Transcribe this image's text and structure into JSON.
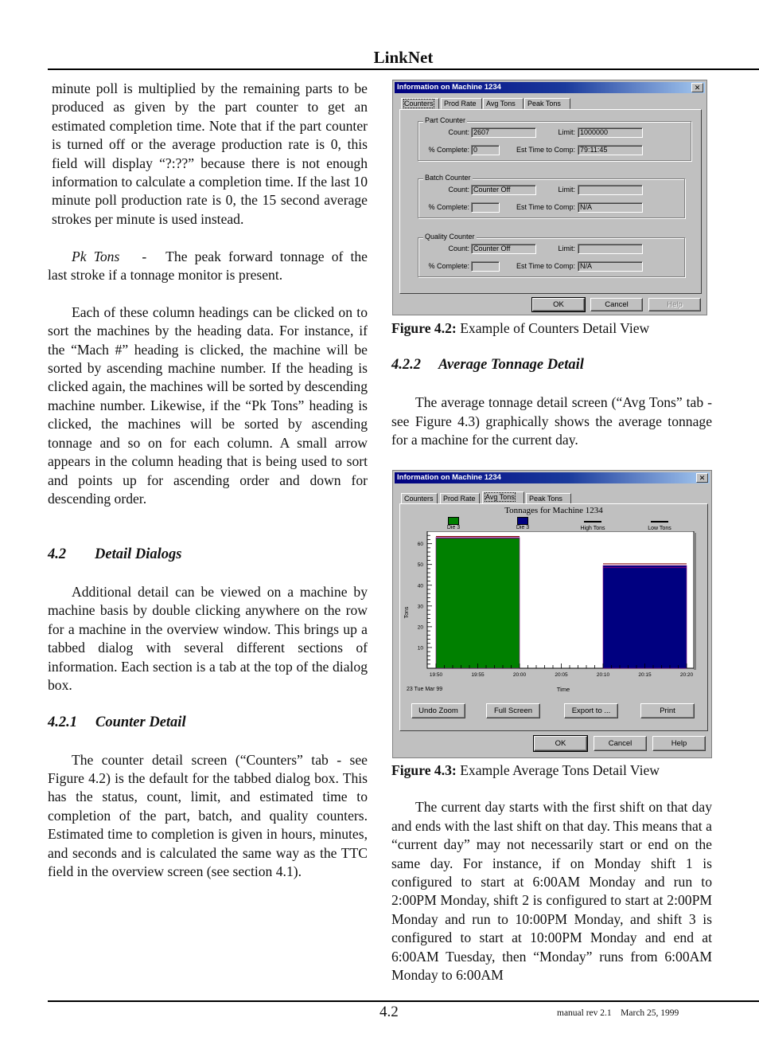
{
  "header": {
    "title": "LinkNet"
  },
  "footer": {
    "page_number": "4.2",
    "revision": "manual rev 2.1",
    "date": "March 25, 1999"
  },
  "left_column": {
    "p1": "minute poll is multiplied by the remaining parts to be produced as given by the part counter to get an estimated completion time.  Note that if the part counter is turned off or the  average production rate is 0, this field will display “?:??” because there is not enough information to calculate a completion time. If the last 10 minute poll production rate is 0, the 15 second average strokes per minute is used instead.",
    "pk_term": "Pk Tons",
    "pk_dash": "-",
    "pk_text": "The peak forward tonnage of the last stroke if a tonnage monitor is present.",
    "p3": "Each of these column headings can be clicked on to sort the machines by the heading data.  For instance, if the “Mach #” heading is clicked, the machine will be sorted by ascending machine number.  If the heading is clicked again, the machines will be sorted by descending machine number.  Likewise, if the “Pk Tons” heading is clicked, the machines will be sorted by ascending tonnage and so on for each column.  A small arrow appears in the column heading that is being used to sort and points up for ascending order and down for descending order.",
    "section_42_num": "4.2",
    "section_42_title": "Detail Dialogs",
    "p4": "Additional detail can be viewed on a machine by machine basis by double clicking anywhere on the row for a machine in the overview window.  This brings up a tabbed dialog with several different sections of information.  Each section is a tab at the top of the dialog box.",
    "section_421_num": "4.2.1",
    "section_421_title": "Counter Detail",
    "p5": "The counter detail screen  (“Counters” tab - see Figure 4.2) is the default for the tabbed dialog box. This has the status, count, limit, and estimated time to completion of the part, batch, and quality counters.  Estimated time to completion is given in hours, minutes, and seconds and is calculated the same way as the TTC field in the overview screen (see section 4.1)."
  },
  "right_column": {
    "fig42_label": "Figure 4.2:",
    "fig42_text": "Example of Counters Detail View",
    "section_422_num": "4.2.2",
    "section_422_title": "Average Tonnage Detail",
    "p1": "The average tonnage detail screen (“Avg Tons” tab - see Figure 4.3) graphically shows the average tonnage for a machine for the current day.",
    "fig43_label": "Figure 4.3:",
    "fig43_text": "Example Average Tons Detail View",
    "p2": "The current day starts with the first shift on that day and ends with the last shift on that day.  This means that a “current day” may not necessarily start or end on the same day.  For instance, if on Monday shift 1 is configured to start at 6:00AM Monday and run to 2:00PM Monday, shift 2 is configured to start at 2:00PM Monday and run to 10:00PM Monday, and shift 3 is configured to start at 10:00PM Monday and end at 6:00AM Tuesday, then “Monday” runs from 6:00AM Monday to 6:00AM"
  },
  "dialog1": {
    "title": "Information on Machine 1234",
    "close": "✕",
    "tabs": [
      "Counters",
      "Prod Rate",
      "Avg Tons",
      "Peak Tons"
    ],
    "active_tab": "Counters",
    "labels": {
      "count": "Count:",
      "limit": "Limit:",
      "pct": "% Complete:",
      "est": "Est Time to Comp:"
    },
    "groups": [
      {
        "title": "Part Counter",
        "count": "2607",
        "limit": "1000000",
        "pct_complete": "0",
        "est_time": "79:11:45"
      },
      {
        "title": "Batch Counter",
        "count": "Counter Off",
        "limit": "",
        "pct_complete": "",
        "est_time": "N/A"
      },
      {
        "title": "Quality Counter",
        "count": "Counter Off",
        "limit": "",
        "pct_complete": "",
        "est_time": "N/A"
      }
    ],
    "buttons": {
      "ok": "OK",
      "cancel": "Cancel",
      "help": "Help"
    }
  },
  "dialog2": {
    "title": "Information on Machine 1234",
    "close": "✕",
    "tabs": [
      "Counters",
      "Prod Rate",
      "Avg Tons",
      "Peak Tons"
    ],
    "active_tab": "Avg Tons",
    "tool_buttons": {
      "undo_zoom": "Undo Zoom",
      "full_screen": "Full Screen",
      "export": "Export to ...",
      "print": "Print"
    },
    "buttons": {
      "ok": "OK",
      "cancel": "Cancel",
      "help": "Help"
    }
  },
  "chart_data": {
    "type": "bar",
    "title": "Tonnages for Machine 1234",
    "xlabel": "Time",
    "ylabel": "Tons",
    "date_label": "23 Tue Mar 99",
    "x_ticks": [
      "19:50",
      "19:55",
      "20:00",
      "20:05",
      "20:10",
      "20:15",
      "20:20"
    ],
    "y_ticks": [
      10,
      20,
      30,
      40,
      50,
      60
    ],
    "ylim": [
      0,
      66
    ],
    "legend": [
      {
        "name": "Die 3",
        "kind": "swatch",
        "color": "#008000"
      },
      {
        "name": "Die 3",
        "kind": "swatch",
        "color": "#000080"
      },
      {
        "name": "High Tons",
        "kind": "line",
        "color": "#000000"
      },
      {
        "name": "Low Tons",
        "kind": "line",
        "color": "#000000"
      }
    ],
    "series": [
      {
        "name": "Die 3",
        "start": "19:50",
        "end": "20:00",
        "value": 63,
        "high": 63.5,
        "low": 62.7,
        "color": "#008000"
      },
      {
        "name": "Die 3",
        "start": "20:10",
        "end": "20:20",
        "value": 49.5,
        "high": 50.3,
        "low": 48.5,
        "color": "#000080"
      }
    ],
    "colors": {
      "high_line": "#800000",
      "low_line": "#800080"
    }
  }
}
